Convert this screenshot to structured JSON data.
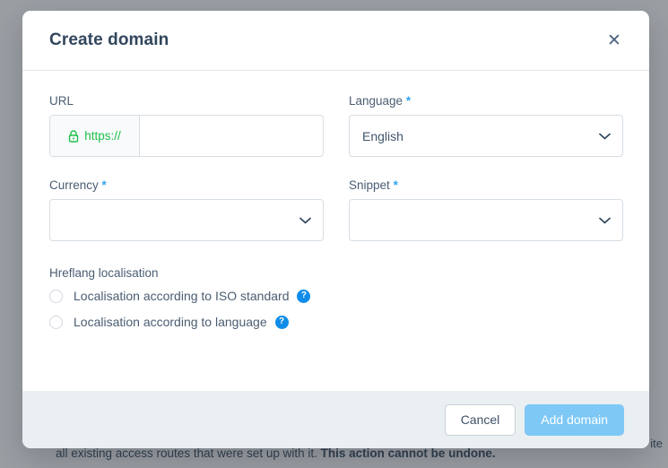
{
  "background": {
    "tail_text_plain": "all existing access routes that were set up with it. ",
    "tail_text_bold": "This action cannot be undone.",
    "right_edge_text": "ite"
  },
  "modal": {
    "title": "Create domain",
    "close_icon": "close-icon",
    "fields": {
      "url": {
        "label": "URL",
        "required": false,
        "prefix_text": "https://",
        "prefix_icon": "lock-icon",
        "value": "",
        "placeholder": ""
      },
      "language": {
        "label": "Language",
        "required": true,
        "required_marker": "*",
        "value": "English",
        "chevron_icon": "chevron-down-icon"
      },
      "currency": {
        "label": "Currency",
        "required": true,
        "required_marker": "*",
        "value": "",
        "chevron_icon": "chevron-down-icon"
      },
      "snippet": {
        "label": "Snippet",
        "required": true,
        "required_marker": "*",
        "value": "",
        "chevron_icon": "chevron-down-icon"
      }
    },
    "hreflang": {
      "title": "Hreflang localisation",
      "options": [
        {
          "label": "Localisation according to ISO standard",
          "selected": false,
          "help_icon": "help-icon",
          "help_glyph": "?"
        },
        {
          "label": "Localisation according to language",
          "selected": false,
          "help_icon": "help-icon",
          "help_glyph": "?"
        }
      ]
    },
    "footer": {
      "cancel_label": "Cancel",
      "submit_label": "Add domain",
      "submit_disabled": true
    }
  },
  "colors": {
    "accent_blue": "#0f8ce9",
    "primary_disabled": "#7ec8f5",
    "green": "#1fc04a",
    "title_text": "#31465c",
    "label_text": "#4a5d72",
    "footer_bg": "#eaeff2",
    "scrim": "rgba(33,43,54,0.45)"
  }
}
